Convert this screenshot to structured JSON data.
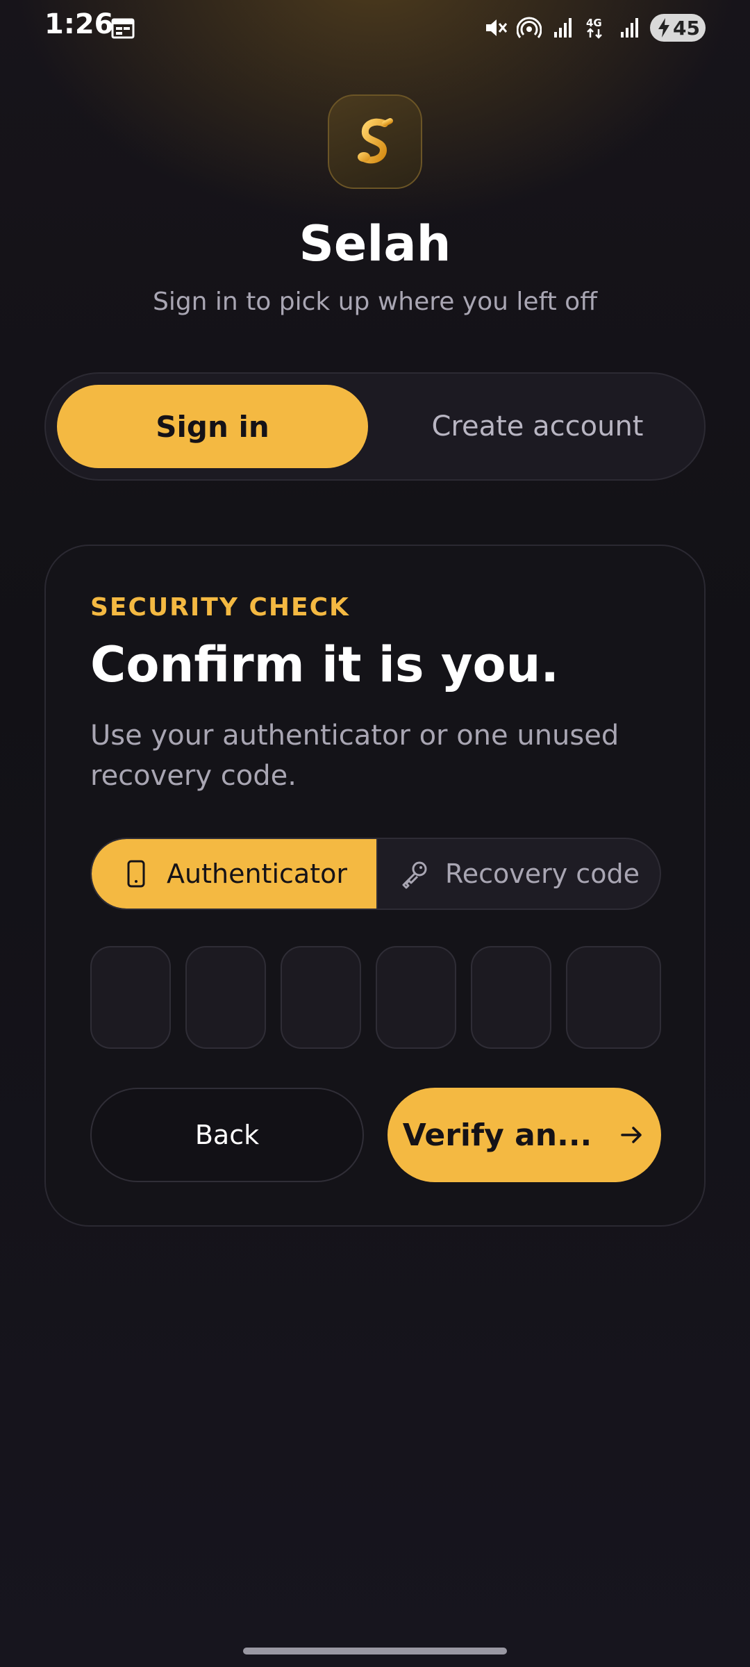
{
  "status_bar": {
    "time": "1:26",
    "battery": "45",
    "icons": [
      "calendar-icon",
      "mute-icon",
      "hotspot-icon",
      "signal-icon",
      "4g-icon",
      "signal-icon",
      "battery-charging-icon"
    ]
  },
  "brand": {
    "logo_icon": "music-note-s-logo",
    "title": "Selah",
    "subtitle": "Sign in to pick up where you left off"
  },
  "auth_tabs": {
    "sign_in": "Sign in",
    "create_account": "Create account",
    "selected": "Sign in"
  },
  "security": {
    "eyebrow": "SECURITY CHECK",
    "title": "Confirm it is you.",
    "description": "Use your authenticator or one unused recovery code.",
    "methods": {
      "authenticator": "Authenticator",
      "recovery": "Recovery code",
      "selected": "Authenticator"
    },
    "code_digits": [
      "",
      "",
      "",
      "",
      "",
      ""
    ],
    "back_label": "Back",
    "verify_label": "Verify an..."
  },
  "colors": {
    "accent": "#f4b942",
    "background": "#121116",
    "card": "#141318",
    "muted_text": "#a9a6b3"
  }
}
